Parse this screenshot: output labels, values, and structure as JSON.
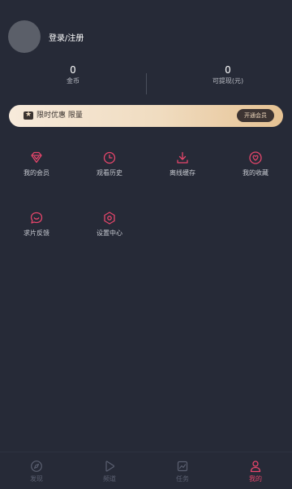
{
  "header": {
    "login_label": "登录/注册"
  },
  "stats": {
    "coins": {
      "value": "0",
      "label": "金币"
    },
    "withdrawable": {
      "value": "0",
      "label": "可提现(元)"
    }
  },
  "vip_banner": {
    "text": "限时优惠 限量",
    "button_label": "开通会员",
    "icon": "ticket-star-icon"
  },
  "grid": [
    {
      "label": "我的会员",
      "icon": "diamond-icon"
    },
    {
      "label": "观看历史",
      "icon": "clock-icon"
    },
    {
      "label": "离线缓存",
      "icon": "download-icon"
    },
    {
      "label": "我的收藏",
      "icon": "heart-icon"
    },
    {
      "label": "求片反馈",
      "icon": "chat-smile-icon"
    },
    {
      "label": "设置中心",
      "icon": "settings-hexagon-icon"
    }
  ],
  "tabbar": {
    "active": "我的",
    "tabs": [
      {
        "label": "发现",
        "icon": "compass-icon"
      },
      {
        "label": "频道",
        "icon": "play-icon"
      },
      {
        "label": "任务",
        "icon": "chart-icon"
      },
      {
        "label": "我的",
        "icon": "user-icon"
      }
    ]
  },
  "colors": {
    "background": "#262a37",
    "accent": "#e6466b",
    "banner_gold": "#f0dcc0"
  }
}
